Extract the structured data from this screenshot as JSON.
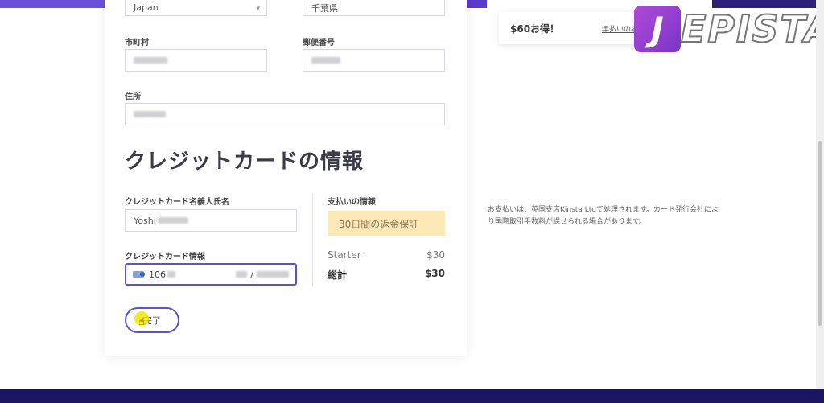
{
  "address": {
    "country_value": "Japan",
    "prefecture_value": "千葉県",
    "city_label": "市町村",
    "postal_label": "郵便番号",
    "street_label": "住所"
  },
  "credit_card": {
    "section_title": "クレジットカードの情報",
    "holder_label": "クレジットカード名義人氏名",
    "holder_value": "Yoshi",
    "card_label": "クレジットカード情報",
    "card_number_prefix": "106",
    "expiry_sep": "/"
  },
  "payment_summary": {
    "label": "支払いの情報",
    "guarantee": "30日間の返金保証",
    "plan_name": "Starter",
    "plan_price": "$30",
    "total_label": "総計",
    "total_price": "$30"
  },
  "finish_button": {
    "label": "完了"
  },
  "promo": {
    "text": "$60お得！",
    "link": "年払いの場"
  },
  "notice": {
    "text": "お支払いは、英国支店Kinsta Ltdで処理されます。カード発行会社により国際取引手数料が課せられる場合があります。"
  },
  "logo": {
    "letter": "J",
    "text": "EPISTA"
  },
  "colors": {
    "accent": "#5a55c7",
    "guarantee_bg": "#fbe8b6",
    "footer": "#1c1660"
  }
}
